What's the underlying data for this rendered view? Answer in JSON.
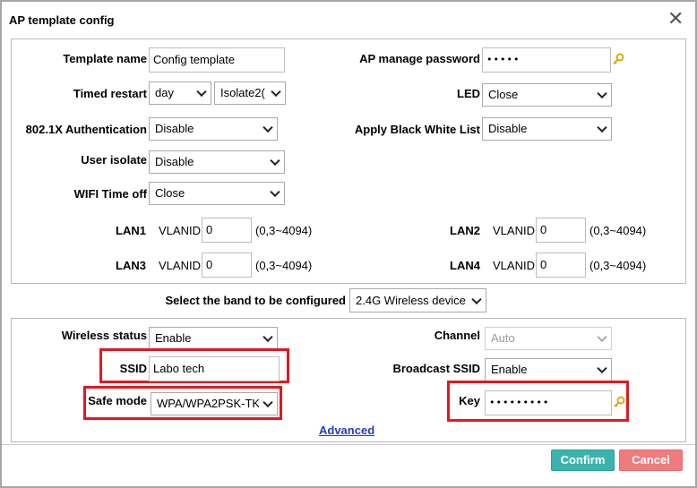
{
  "dialog": {
    "title": "AP template config",
    "close_glyph": "✕"
  },
  "fields": {
    "template_name_label": "Template name",
    "template_name_value": "Config template",
    "ap_password_label": "AP manage password",
    "ap_password_value": "•••••",
    "timed_restart_label": "Timed restart",
    "timed_restart_period": "day",
    "timed_restart_mode": "Isolate2(",
    "led_label": "LED",
    "led_value": "Close",
    "auth_label": "802.1X Authentication",
    "auth_value": "Disable",
    "bwlist_label": "Apply Black White List",
    "bwlist_value": "Disable",
    "user_isolate_label": "User isolate",
    "user_isolate_value": "Disable",
    "wifi_timeoff_label": "WIFI Time off",
    "wifi_timeoff_value": "Close"
  },
  "lan": {
    "vlanid_label": "VLANID",
    "range_text": "(0,3~4094)",
    "ports": [
      {
        "name": "LAN1",
        "value": "0"
      },
      {
        "name": "LAN2",
        "value": "0"
      },
      {
        "name": "LAN3",
        "value": "0"
      },
      {
        "name": "LAN4",
        "value": "0"
      }
    ]
  },
  "band": {
    "label": "Select the band to be configured",
    "value": "2.4G Wireless device"
  },
  "wireless": {
    "status_label": "Wireless status",
    "status_value": "Enable",
    "channel_label": "Channel",
    "channel_value": "Auto",
    "ssid_label": "SSID",
    "ssid_value": "Labo tech",
    "broadcast_label": "Broadcast SSID",
    "broadcast_value": "Enable",
    "safe_mode_label": "Safe mode",
    "safe_mode_value": "WPA/WPA2PSK-TK",
    "key_label": "Key",
    "key_value": "•••••••••",
    "advanced_link": "Advanced"
  },
  "buttons": {
    "confirm": "Confirm",
    "cancel": "Cancel"
  },
  "colors": {
    "confirm": "#3bb3ad",
    "cancel": "#f07b7f",
    "highlight": "#e8161d",
    "link": "#1e3cc8",
    "key_icon": "#e0a80f"
  },
  "icons": {
    "key": "key-icon"
  }
}
